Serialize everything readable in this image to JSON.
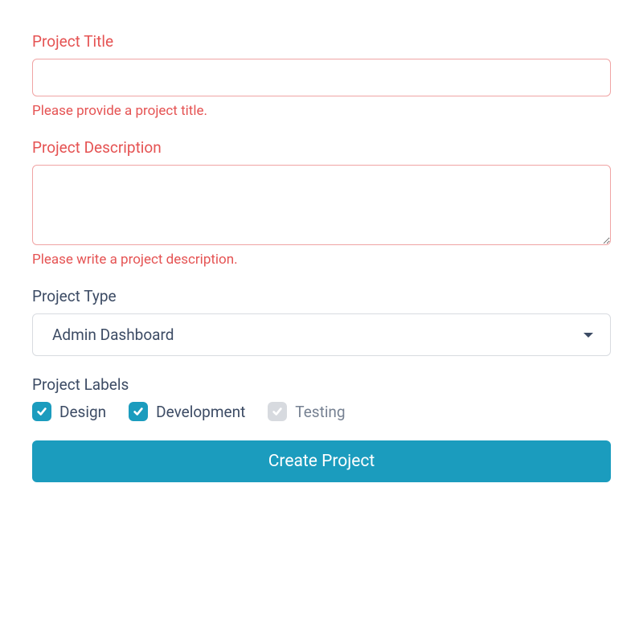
{
  "title": {
    "label": "Project Title",
    "value": "",
    "error": "Please provide a project title."
  },
  "description": {
    "label": "Project Description",
    "value": "",
    "error": "Please write a project description."
  },
  "type": {
    "label": "Project Type",
    "selected": "Admin Dashboard"
  },
  "labels": {
    "label": "Project Labels",
    "options": [
      {
        "text": "Design",
        "checked": true,
        "disabled": false
      },
      {
        "text": "Development",
        "checked": true,
        "disabled": false
      },
      {
        "text": "Testing",
        "checked": true,
        "disabled": true
      }
    ]
  },
  "submit": {
    "label": "Create Project"
  }
}
